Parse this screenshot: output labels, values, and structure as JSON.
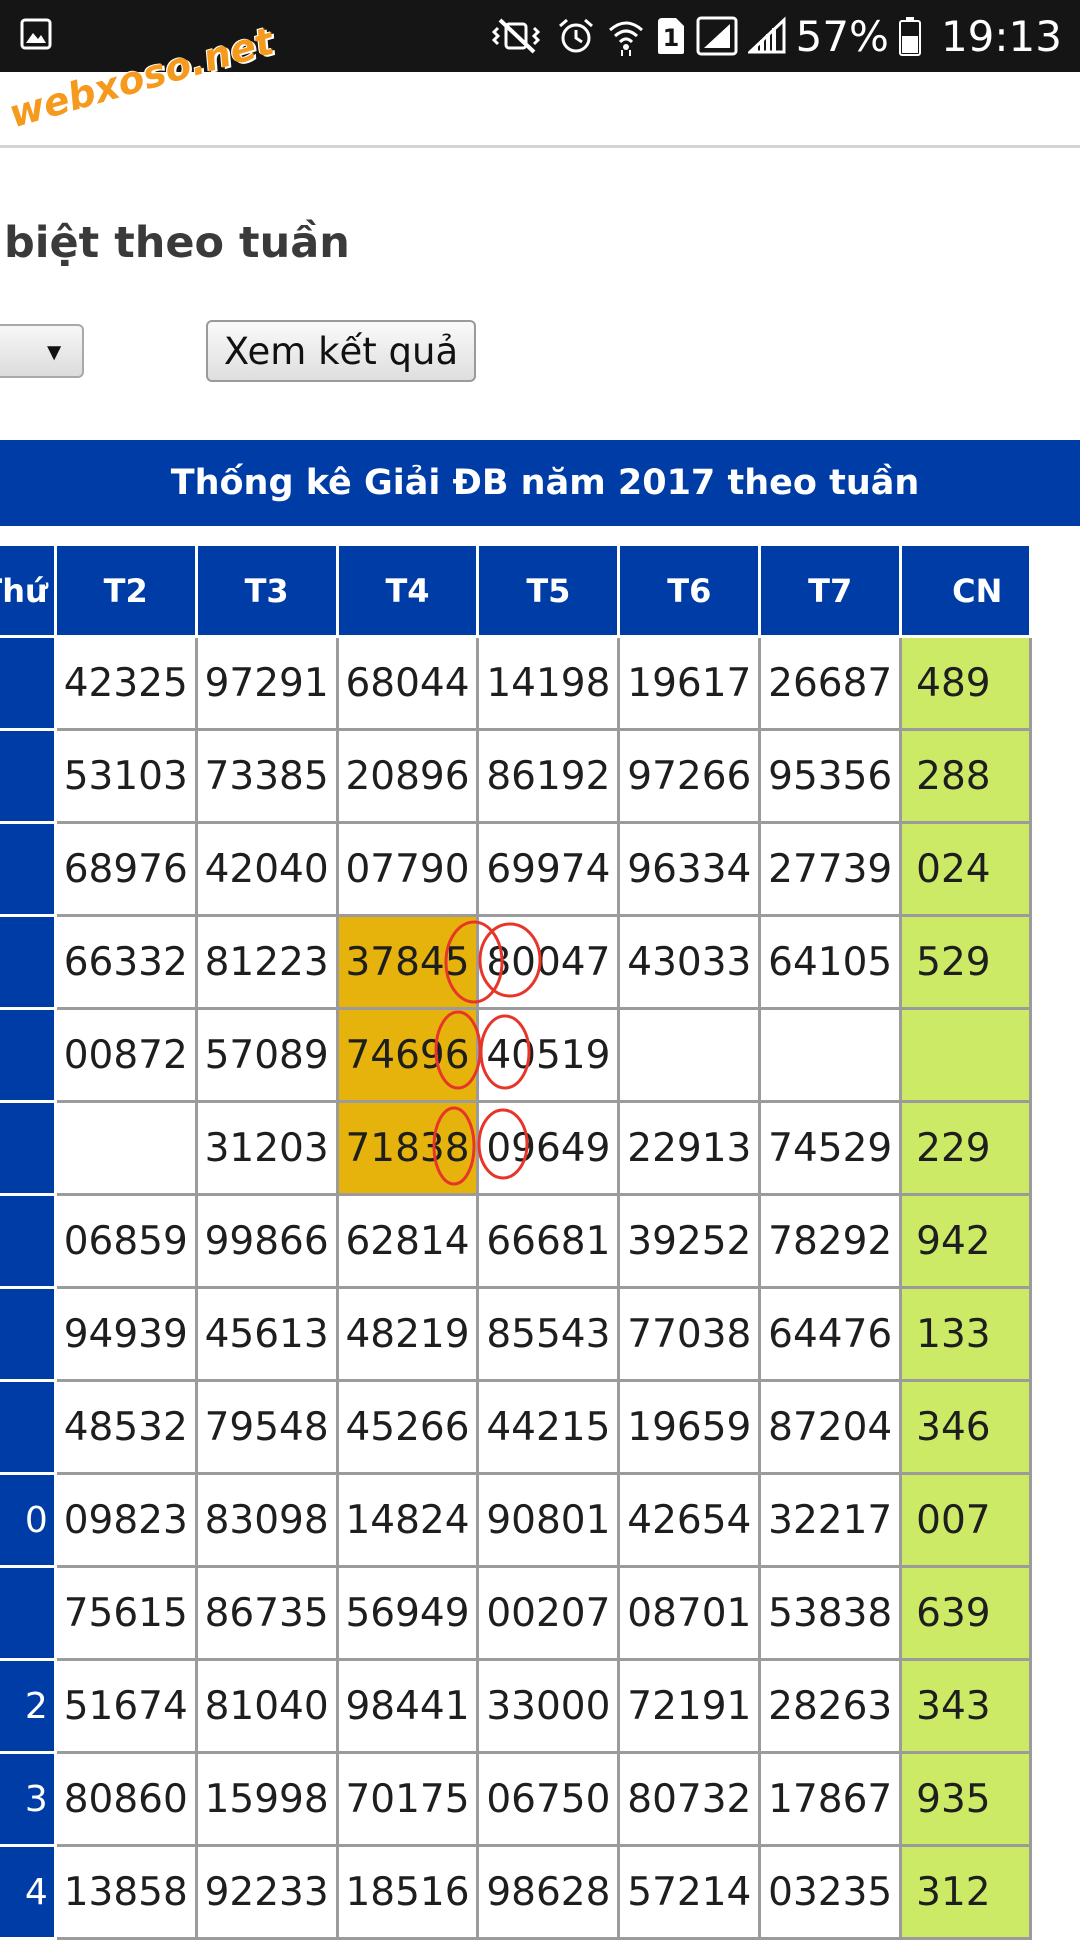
{
  "status_bar": {
    "battery": "57%",
    "time": "19:13",
    "sim_slot": "1",
    "icons": [
      "gallery-icon",
      "mute-vibrate-icon",
      "alarm-icon",
      "wifi-icon",
      "sim-icon",
      "signal-icon",
      "signal-icon-2",
      "battery-icon"
    ]
  },
  "watermark": "webxoso.net",
  "page": {
    "title": "biệt theo tuần",
    "select_arrow": "▼",
    "view_button": "Xem kết quả"
  },
  "table": {
    "banner": "Thống kê Giải ĐB năm 2017 theo tuần",
    "headers": [
      "Thứ",
      "T2",
      "T3",
      "T4",
      "T5",
      "T6",
      "T7",
      "CN"
    ],
    "rows": [
      {
        "week": "",
        "cells": [
          "42325",
          "97291",
          "68044",
          "14198",
          "19617",
          "26687",
          "489"
        ]
      },
      {
        "week": "",
        "cells": [
          "53103",
          "73385",
          "20896",
          "86192",
          "97266",
          "95356",
          "288"
        ]
      },
      {
        "week": "",
        "cells": [
          "68976",
          "42040",
          "07790",
          "69974",
          "96334",
          "27739",
          "024"
        ]
      },
      {
        "week": "",
        "cells": [
          "66332",
          "81223",
          "37845",
          "80047",
          "43033",
          "64105",
          "529"
        ]
      },
      {
        "week": "",
        "cells": [
          "00872",
          "57089",
          "74696",
          "40519",
          "",
          "",
          ""
        ]
      },
      {
        "week": "",
        "cells": [
          "",
          "31203",
          "71838",
          "09649",
          "22913",
          "74529",
          "229"
        ]
      },
      {
        "week": "",
        "cells": [
          "06859",
          "99866",
          "62814",
          "66681",
          "39252",
          "78292",
          "942"
        ]
      },
      {
        "week": "",
        "cells": [
          "94939",
          "45613",
          "48219",
          "85543",
          "77038",
          "64476",
          "133"
        ]
      },
      {
        "week": "",
        "cells": [
          "48532",
          "79548",
          "45266",
          "44215",
          "19659",
          "87204",
          "346"
        ]
      },
      {
        "week": "0",
        "cells": [
          "09823",
          "83098",
          "14824",
          "90801",
          "42654",
          "32217",
          "007"
        ]
      },
      {
        "week": "",
        "cells": [
          "75615",
          "86735",
          "56949",
          "00207",
          "08701",
          "53838",
          "639"
        ]
      },
      {
        "week": "2",
        "cells": [
          "51674",
          "81040",
          "98441",
          "33000",
          "72191",
          "28263",
          "343"
        ]
      },
      {
        "week": "3",
        "cells": [
          "80860",
          "15998",
          "70175",
          "06750",
          "80732",
          "17867",
          "935"
        ]
      },
      {
        "week": "4",
        "cells": [
          "13858",
          "92233",
          "18516",
          "98628",
          "57214",
          "03235",
          "312"
        ]
      }
    ],
    "highlighted": [
      [
        3,
        2
      ],
      [
        4,
        2
      ],
      [
        5,
        2
      ]
    ]
  },
  "colors": {
    "header_blue": "#003ca5",
    "sunday_green": "#cdea66",
    "highlight_gold": "#e6b30c",
    "annotation_red": "#e8352a",
    "watermark_orange": "#f59a1c"
  }
}
